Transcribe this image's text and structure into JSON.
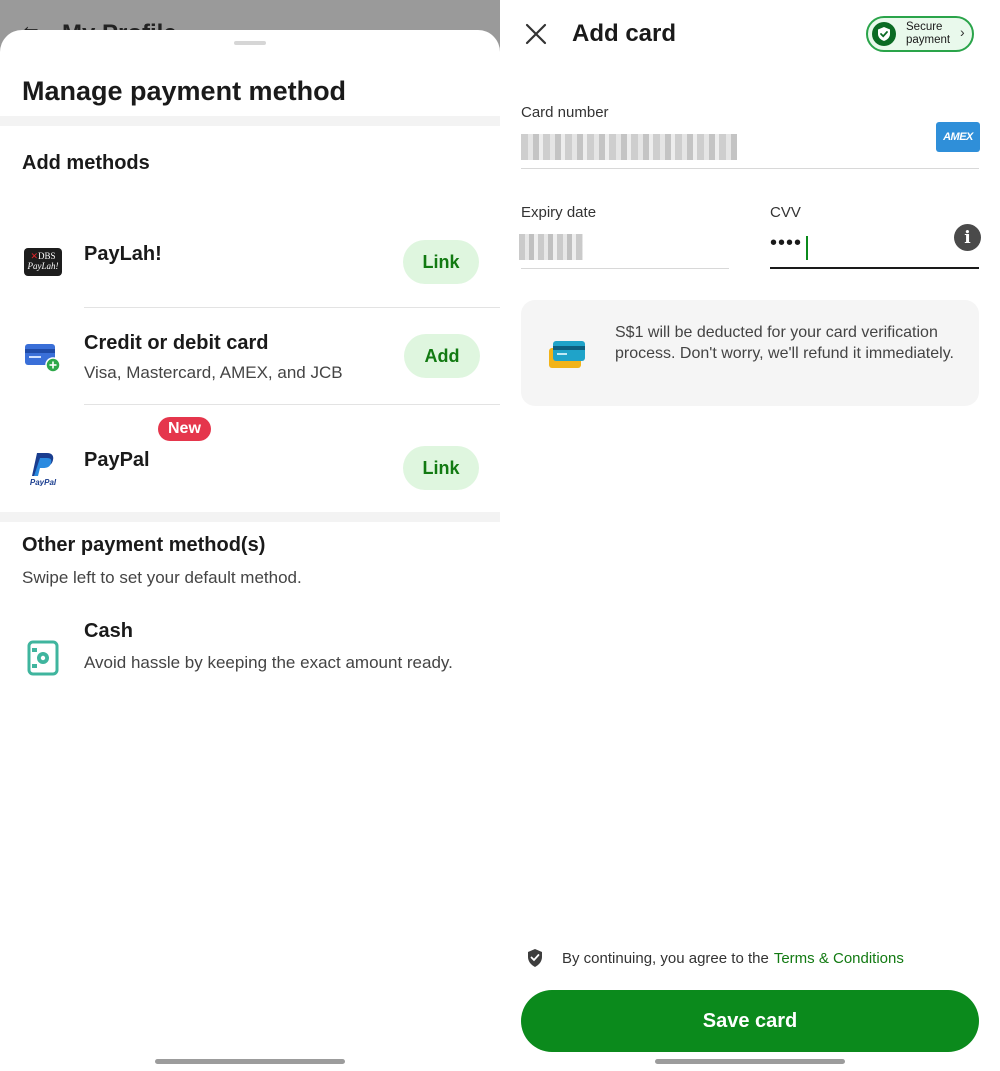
{
  "left": {
    "behind_title": "My Profile",
    "title": "Manage payment method",
    "add_methods": {
      "heading": "Add methods",
      "items": [
        {
          "name": "PayLah!",
          "icon": "dbs-paylah-icon",
          "icon_text": "DBS PayLah!",
          "button": "Link"
        },
        {
          "name": "Credit or debit card",
          "subtitle": "Visa, Mastercard, AMEX, and JCB",
          "icon": "credit-card-add-icon",
          "button": "Add"
        },
        {
          "name": "PayPal",
          "badge": "New",
          "icon": "paypal-icon",
          "icon_text": "PayPal",
          "button": "Link"
        }
      ]
    },
    "other": {
      "heading": "Other payment method(s)",
      "hint": "Swipe left to set your default method.",
      "items": [
        {
          "name": "Cash",
          "subtitle": "Avoid hassle by keeping the exact amount ready.",
          "icon": "cash-icon"
        }
      ]
    }
  },
  "right": {
    "title": "Add card",
    "secure_badge": {
      "line1": "Secure",
      "line2": "payment"
    },
    "card_number": {
      "label": "Card number",
      "brand": "AMEX"
    },
    "expiry": {
      "label": "Expiry date"
    },
    "cvv": {
      "label": "CVV",
      "value": "••••"
    },
    "notice": "S$1 will be deducted for your card verification process. Don't worry, we'll refund it immediately.",
    "terms": {
      "prefix": "By continuing, you agree to the",
      "link": "Terms & Conditions"
    },
    "save_button": "Save card"
  },
  "colors": {
    "primary_green": "#0b8a1c",
    "light_green": "#dff6df",
    "badge_red": "#e5364c",
    "amex_blue": "#2f8fd9"
  }
}
